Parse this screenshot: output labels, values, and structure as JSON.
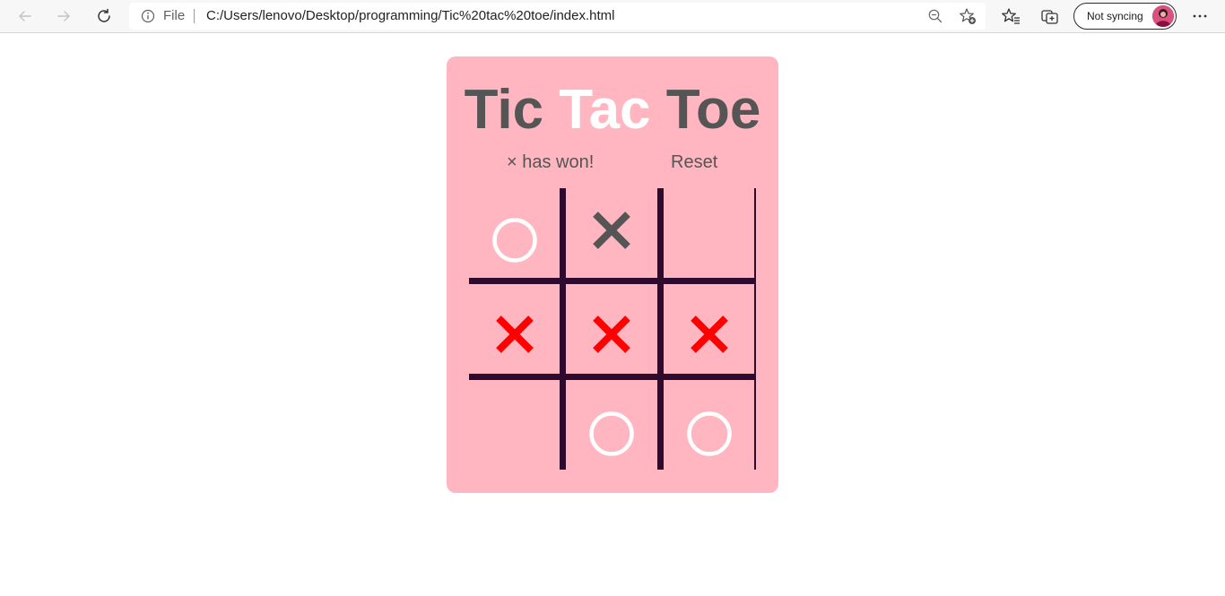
{
  "browser": {
    "back_icon": "arrow-left-icon",
    "forward_icon": "arrow-right-icon",
    "refresh_icon": "refresh-icon",
    "address": {
      "info_icon": "info-icon",
      "scheme_label": "File",
      "url": "C:/Users/lenovo/Desktop/programming/Tic%20tac%20toe/index.html",
      "zoom_icon": "zoom-out-icon",
      "favorite_icon": "add-favorite-icon"
    },
    "favorites_icon": "favorites-icon",
    "collections_icon": "collections-icon",
    "profile": {
      "label": "Not syncing",
      "avatar_icon": "avatar-icon"
    },
    "menu_icon": "more-icon"
  },
  "game": {
    "title_parts": [
      "Tic",
      "Tac",
      "Toe"
    ],
    "status": "× has won!",
    "reset_label": "Reset",
    "board": [
      [
        "O",
        "X",
        ""
      ],
      [
        "X",
        "X",
        "X"
      ],
      [
        "",
        "O",
        "O"
      ]
    ],
    "winning_row": 1
  },
  "colors": {
    "card_background": "#ffb6c1",
    "title_text": "#555555",
    "title_highlight": "#ffffff",
    "grid_lines": "#2e0a2e",
    "mark_x": "#555555",
    "mark_x_winning": "#ff0000",
    "mark_o": "#ffffff"
  }
}
